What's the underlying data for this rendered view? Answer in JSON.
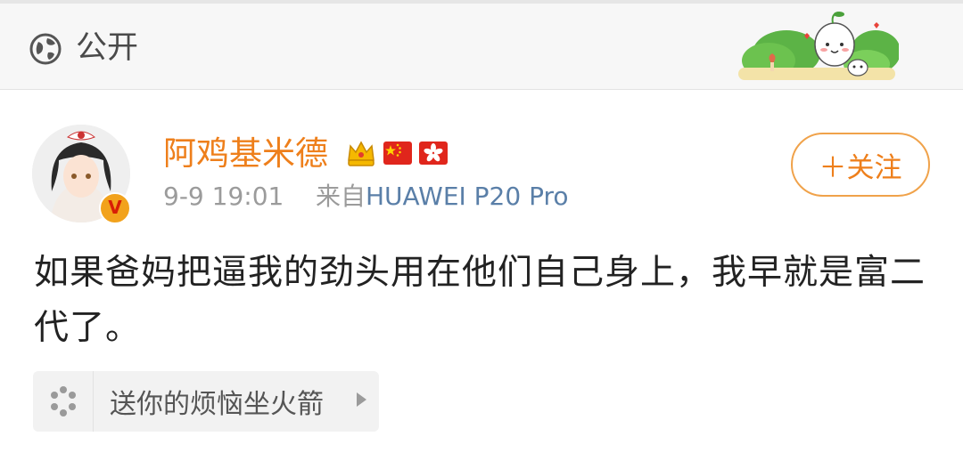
{
  "header": {
    "visibility_icon": "globe-icon",
    "visibility_label": "公开"
  },
  "author": {
    "name": "阿鸡基米德",
    "verified_mark": "V",
    "badges": [
      "crown-badge",
      "china-flag",
      "hong-kong-flag"
    ],
    "time": "9-9 19:01",
    "source_prefix": "来自",
    "source": "HUAWEI P20 Pro"
  },
  "follow": {
    "label": "＋关注"
  },
  "post": {
    "text": "如果爸妈把逼我的劲头用在他们自己身上，我早就是富二代了。"
  },
  "gift": {
    "icon": "gift-icon",
    "label": "送你的烦恼坐火箭"
  },
  "colors": {
    "accent": "#ee7f1b",
    "source_link": "#5a7fa8",
    "meta_gray": "#9b9b9b",
    "header_bg": "#f7f7f7"
  }
}
